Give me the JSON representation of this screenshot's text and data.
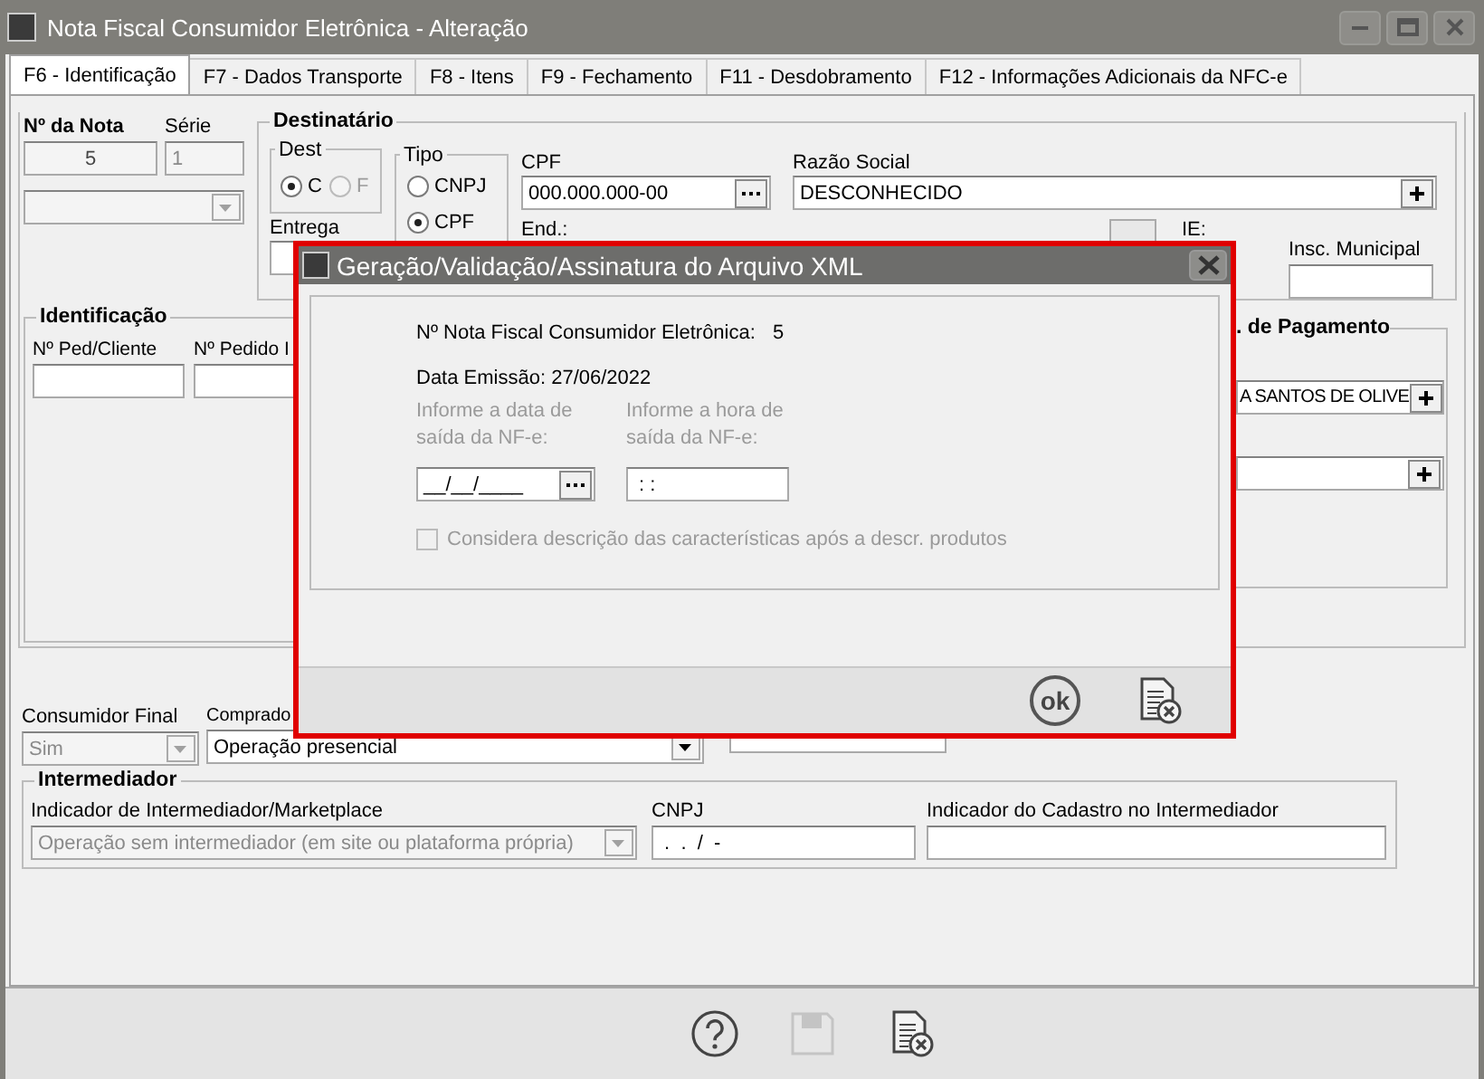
{
  "window": {
    "title": "Nota Fiscal Consumidor Eletrônica - Alteração"
  },
  "tabs": [
    {
      "label": "F6 - Identificação",
      "selected": true
    },
    {
      "label": "F7 - Dados Transporte",
      "selected": false
    },
    {
      "label": "F8 - Itens",
      "selected": false
    },
    {
      "label": "F9 - Fechamento",
      "selected": false
    },
    {
      "label": "F11 - Desdobramento",
      "selected": false
    },
    {
      "label": "F12 - Informações Adicionais da NFC-e",
      "selected": false
    }
  ],
  "nota": {
    "numero_label": "Nº da Nota",
    "numero": "5",
    "serie_label": "Série",
    "serie": "1"
  },
  "destinatario": {
    "title": "Destinatário",
    "dest_title": "Dest",
    "dest_options": [
      {
        "label": "C",
        "selected": true,
        "disabled": false
      },
      {
        "label": "F",
        "selected": false,
        "disabled": true
      }
    ],
    "entrega_label": "Entrega",
    "tipo_title": "Tipo",
    "tipo_options": [
      {
        "label": "CNPJ",
        "selected": false
      },
      {
        "label": "CPF",
        "selected": true
      }
    ],
    "cpf_label": "CPF",
    "cpf": "000.000.000-00",
    "end_label": "End.:",
    "razao_label": "Razão Social",
    "razao": "DESCONHECIDO",
    "ie_label": "IE:",
    "insc_label": "Insc. Municipal"
  },
  "identificacao": {
    "title": "Identificação",
    "fields": [
      {
        "label": "Nº Ped/Cliente"
      },
      {
        "label": "Nº Pedido I"
      }
    ]
  },
  "pagamento": {
    "title": ". de Pagamento",
    "value": "A SANTOS DE OLIVE"
  },
  "consumidor_final": {
    "label": "Consumidor Final",
    "value": "Sim",
    "disabled": true
  },
  "comprador": {
    "label": "Comprado",
    "value": "Operação presencial",
    "disabled": false
  },
  "intermediador": {
    "title": "Intermediador",
    "indicador_label": "Indicador de Intermediador/Marketplace",
    "indicador": "Operação sem intermediador (em site ou plataforma própria)",
    "indicador_disabled": true,
    "cnpj_label": "CNPJ",
    "cnpj": " .  .  /  -",
    "cadastro_label": "Indicador do Cadastro no Intermediador"
  },
  "toolbar": [
    {
      "kind": "help",
      "disabled": false
    },
    {
      "kind": "save",
      "disabled": true
    },
    {
      "kind": "cancel",
      "disabled": false
    }
  ],
  "dialog": {
    "title": "Geração/Validação/Assinatura do Arquivo XML",
    "nota_label": "Nº Nota Fiscal Consumidor Eletrônica:",
    "nota": "5",
    "data_emissao": "Data Emissão: 27/06/2022",
    "data_saida_label": "Informe a data de saída da NF-e:",
    "data_saida": "__/__/____",
    "hora_saida_label": "Informe a hora de saída da NF-e:",
    "hora_saida": " : :",
    "considera": {
      "label": "Considera descrição das características após a descr. produtos",
      "checked": false,
      "disabled": true
    },
    "buttons": [
      {
        "kind": "ok",
        "label": "ok"
      },
      {
        "kind": "cancel"
      }
    ]
  }
}
